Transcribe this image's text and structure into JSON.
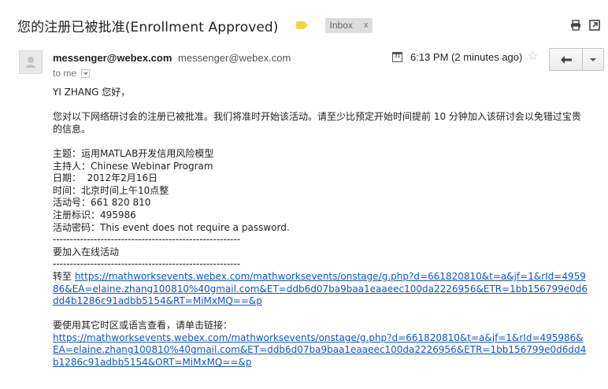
{
  "subject": "您的注册已被批准(Enrollment Approved)",
  "label_color": "#f8d24a",
  "inbox_chip": {
    "label": "Inbox",
    "remove": "x"
  },
  "top_icons": [
    "print-icon",
    "new-window-icon"
  ],
  "sender": {
    "name": "messenger@webex.com",
    "email": "messenger@webex.com"
  },
  "to_line": "to me",
  "calendar_icon_text": "31",
  "timestamp": "6:13 PM (2 minutes ago)",
  "star": "☆",
  "body": {
    "greeting": "YI ZHANG 您好，",
    "intro": "您对以下网络研讨会的注册已被批准。我们将准时开始该活动。请至少比预定开始时间提前 10 分钟加入该研讨会以免错过宝贵的信息。",
    "topic": "主题：运用MATLAB开发信用风险模型",
    "host": "主持人：Chinese Webinar Program",
    "date": "日期：  2012年2月16日",
    "time": "时间：北京时间上午10点整",
    "event_number": "活动号：661 820 810",
    "reg_id": "注册标识：495986",
    "password": "活动密码：This event does not require a password.",
    "divider": "-------------------------------------------------------",
    "join_heading": "要加入在线活动",
    "goto_prefix": "转至 ",
    "join_link": "https://mathworksevents.webex.com/mathworksevents/onstage/g.php?d=661820810&t=a&jf=1&rId=495986&EA=elaine.zhang100810%40gmail.com&ET=ddb6d07ba9baa1eaaeec100da2226956&ETR=1bb156799e0d6dd4b1286c91adbb5154&RT=MiMxMQ==&p",
    "other_tz": "要使用其它时区或语言查看，请单击链接：",
    "tz_link": "https://mathworksevents.webex.com/mathworksevents/onstage/g.php?d=661820810&t=a&jf=1&rId=495986&EA=elaine.zhang100810%40gmail.com&ET=ddb6d07ba9baa1eaaeec100da2226956&ETR=1bb156799e0d6dd4b1286c91adbb5154&ORT=MiMxMQ==&p"
  }
}
